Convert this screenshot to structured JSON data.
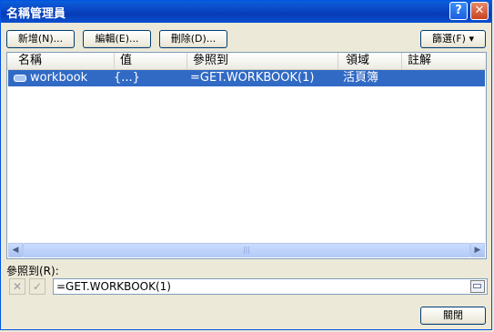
{
  "window": {
    "title": "名稱管理員",
    "help_glyph": "?",
    "close_glyph": "✕"
  },
  "toolbar": {
    "new_label": "新增(N)...",
    "edit_label": "編輯(E)...",
    "delete_label": "刪除(D)...",
    "filter_label": "篩選(F) ▾"
  },
  "list": {
    "columns": [
      "名稱",
      "值",
      "參照到",
      "領域",
      "註解"
    ],
    "rows": [
      {
        "name": "workbook",
        "value": "{...}",
        "refers_to": "=GET.WORKBOOK(1)",
        "scope": "活頁簿",
        "comment": ""
      }
    ],
    "selected_color": "#316ac5"
  },
  "scroll": {
    "left_glyph": "◀",
    "right_glyph": "▶",
    "thumb_glyph": "|||"
  },
  "refers_to": {
    "label": "參照到(R):",
    "cancel_glyph": "✕",
    "confirm_glyph": "✓",
    "value": "=GET.WORKBOOK(1)"
  },
  "footer": {
    "close_label": "關閉"
  }
}
